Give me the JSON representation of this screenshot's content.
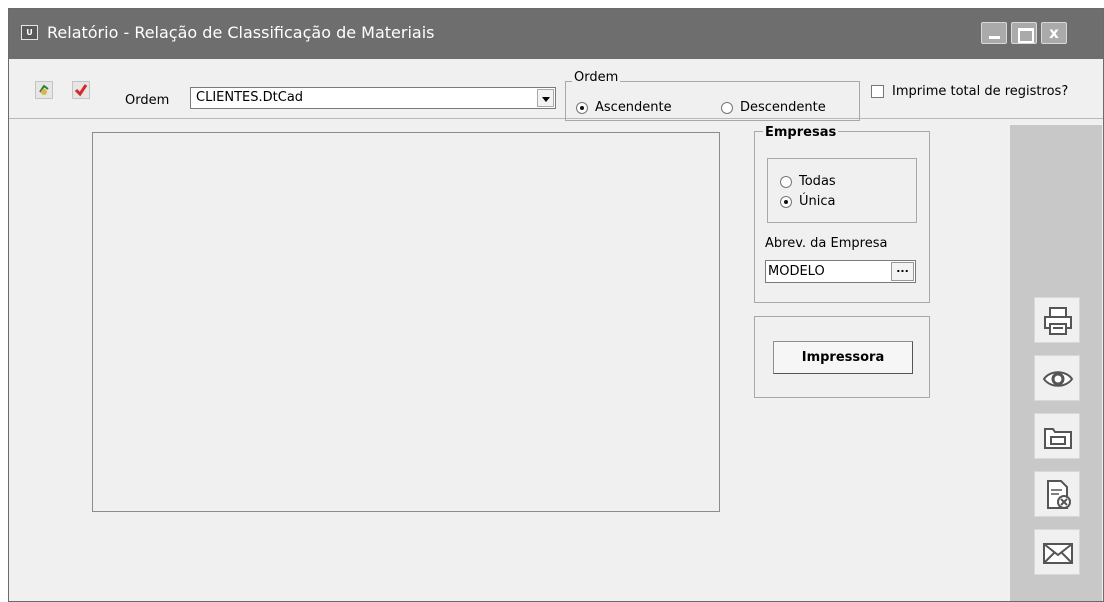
{
  "window": {
    "app_icon_text": "U",
    "title": "Relatório - Relação de Classificação de Materiais",
    "close_glyph": "x"
  },
  "toolbar": {
    "icons": [
      "refresh-icon",
      "check-icon"
    ],
    "ordem_label": "Ordem",
    "ordem_value": "CLIENTES.DtCad",
    "ordem_group_label": "Ordem",
    "asc_label": "Ascendente",
    "desc_label": "Descendente",
    "sort_selected": "Ascendente",
    "total_label": "Imprime total de registros?",
    "total_checked": false
  },
  "empresas": {
    "legend": "Empresas",
    "todas_label": "Todas",
    "unica_label": "Única",
    "selected": "Única",
    "abrev_label": "Abrev. da Empresa",
    "abrev_value": "MODELO",
    "ellipsis": "..."
  },
  "print": {
    "button_label": "Impressora"
  },
  "side_actions": [
    "printer-icon",
    "preview-eye-icon",
    "folder-icon",
    "document-delete-icon",
    "mail-icon"
  ]
}
